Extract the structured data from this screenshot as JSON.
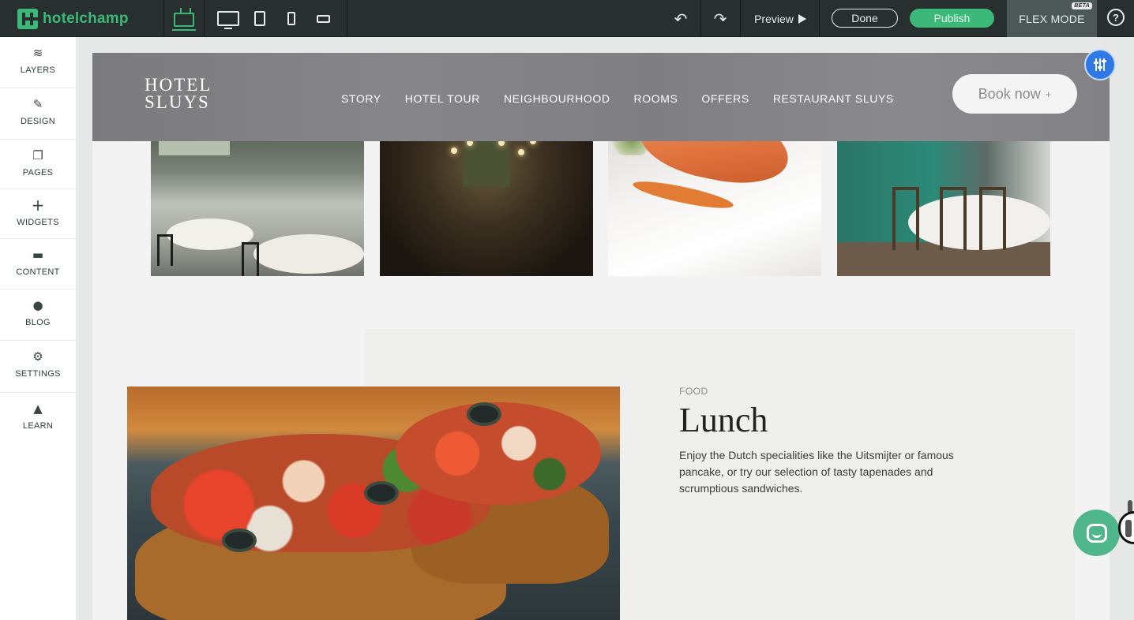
{
  "app": {
    "logo_text": "hotelchamp",
    "toolbar": {
      "preview_label": "Preview",
      "done_label": "Done",
      "publish_label": "Publish",
      "flex_mode_label": "FLEX MODE",
      "beta_badge": "BETA",
      "help_glyph": "?",
      "undo_icon": "undo-icon",
      "redo_icon": "redo-icon",
      "devices": [
        "home-icon",
        "desktop-icon",
        "tablet-icon",
        "mobile-icon",
        "mobile-landscape-icon"
      ]
    },
    "colors": {
      "topbar": "#28302f",
      "accent_green": "#3cb878",
      "flex_handle_blue": "#2f79e6",
      "chat_green": "#4fb58a"
    }
  },
  "sidebar": {
    "items": [
      {
        "label": "LAYERS",
        "icon": "layers-icon"
      },
      {
        "label": "DESIGN",
        "icon": "brush-icon"
      },
      {
        "label": "PAGES",
        "icon": "pages-icon"
      },
      {
        "label": "WIDGETS",
        "icon": "plus-icon"
      },
      {
        "label": "CONTENT",
        "icon": "folder-icon"
      },
      {
        "label": "BLOG",
        "icon": "chat-bubble-icon"
      },
      {
        "label": "SETTINGS",
        "icon": "gear-icon"
      },
      {
        "label": "LEARN",
        "icon": "graduation-cap-icon"
      }
    ]
  },
  "site": {
    "brand_line1": "HOTEL",
    "brand_line2": "SLUYS",
    "nav": [
      "STORY",
      "HOTEL TOUR",
      "NEIGHBOURHOOD",
      "ROOMS",
      "OFFERS",
      "RESTAURANT SLUYS"
    ],
    "book_label": "Book now",
    "book_plus": "+",
    "lunch": {
      "eyebrow": "FOOD",
      "title": "Lunch",
      "description": "Enjoy the Dutch specialities like the Uitsmijter or famous pancake, or try our selection of tasty tapenades and scrumptious sandwiches."
    }
  }
}
